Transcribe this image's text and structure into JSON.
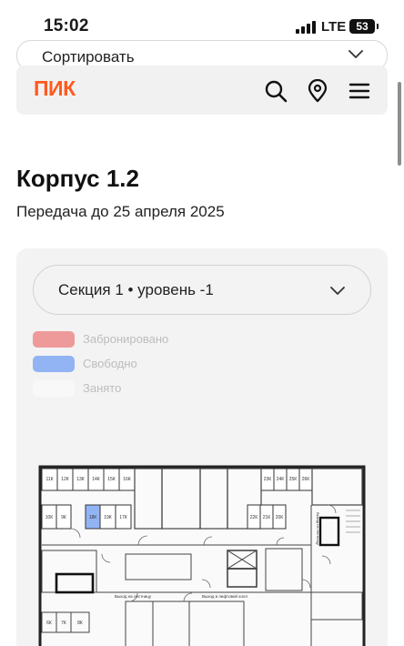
{
  "status": {
    "time": "15:02",
    "network": "LTE",
    "battery": "53"
  },
  "sort": {
    "label": "Сортировать"
  },
  "header": {
    "logo": "ПИК",
    "icons": [
      "search-icon",
      "map-pin-icon",
      "menu-icon"
    ]
  },
  "page": {
    "title": "Корпус 1.2",
    "subtitle": "Передача до 25 апреля 2025"
  },
  "section_select": {
    "value": "Секция 1 • уровень -1"
  },
  "legend": [
    {
      "label": "Забронировано",
      "color": "#ee9a9a"
    },
    {
      "label": "Свободно",
      "color": "#93b4f4"
    },
    {
      "label": "Занято",
      "color": "#f8f8f8"
    }
  ],
  "plan": {
    "top_units": [
      "11К",
      "12К",
      "13К",
      "14К",
      "15К",
      "16К"
    ],
    "right_units": [
      "23К",
      "24К",
      "25К",
      "26К"
    ],
    "lower_units": [
      "10К",
      "9К",
      "18К",
      "19К",
      "17К"
    ],
    "right_lower_units": [
      "22К",
      "21К",
      "20К"
    ],
    "bottom_units": [
      "6К",
      "7К",
      "8К"
    ],
    "exit_left": "Выход на лестницу",
    "exit_center": "Выход в лифтовой холл",
    "stairs_label": "Выход на лестницу",
    "free_color": "#93b4f4"
  }
}
